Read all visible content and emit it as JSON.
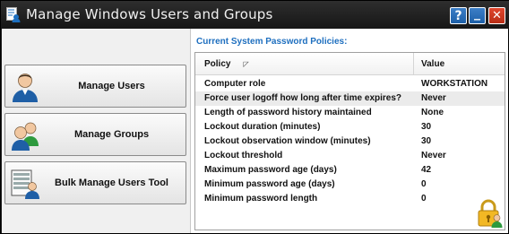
{
  "window": {
    "title": "Manage Windows Users and Groups",
    "help_label": "?",
    "minimize_label": "_",
    "close_label": "✕"
  },
  "sidebar": {
    "items": [
      {
        "label": "Manage Users",
        "icon": "user-icon"
      },
      {
        "label": "Manage Groups",
        "icon": "group-icon"
      },
      {
        "label": "Bulk Manage Users Tool",
        "icon": "bulk-users-icon"
      }
    ]
  },
  "policies": {
    "title": "Current System Password Policies:",
    "columns": {
      "policy": "Policy",
      "value": "Value"
    },
    "rows": [
      {
        "policy": "Computer role",
        "value": "WORKSTATION"
      },
      {
        "policy": "Force user logoff how long after time expires?",
        "value": "Never"
      },
      {
        "policy": "Length of password history maintained",
        "value": "None"
      },
      {
        "policy": "Lockout duration (minutes)",
        "value": "30"
      },
      {
        "policy": "Lockout observation window (minutes)",
        "value": "30"
      },
      {
        "policy": "Lockout threshold",
        "value": "Never"
      },
      {
        "policy": "Maximum password age (days)",
        "value": "42"
      },
      {
        "policy": "Minimum password age (days)",
        "value": "0"
      },
      {
        "policy": "Minimum password length",
        "value": "0"
      }
    ]
  },
  "colors": {
    "accent_blue": "#1e6fbf",
    "close_red": "#c9381f",
    "titlebar": "#1c1c1c"
  }
}
